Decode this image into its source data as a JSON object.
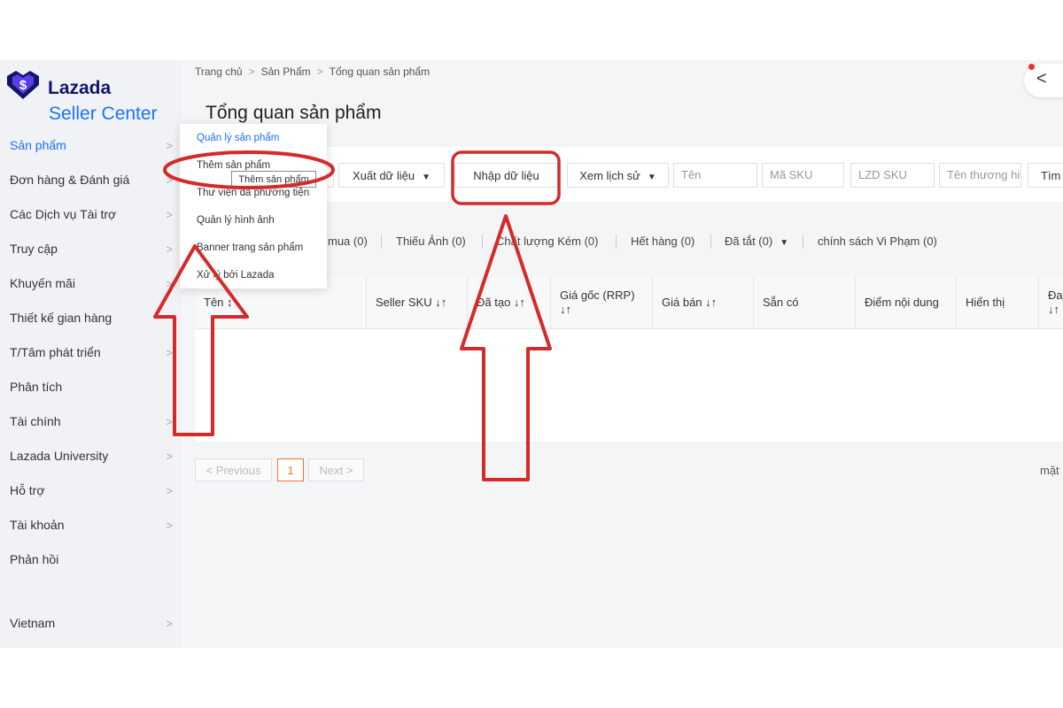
{
  "brand": {
    "name_line1": "Lazada",
    "name_line2": "Seller Center",
    "logo_symbol": "$"
  },
  "sidebar": {
    "items": [
      {
        "label": "Sản phẩm",
        "active": true
      },
      {
        "label": "Đơn hàng & Đánh giá"
      },
      {
        "label": "Các Dịch vụ Tài trợ"
      },
      {
        "label": "Truy cập"
      },
      {
        "label": "Khuyến mãi"
      },
      {
        "label": "Thiết kế gian hàng"
      },
      {
        "label": "T/Tâm phát triển"
      },
      {
        "label": "Phân tích"
      },
      {
        "label": "Tài chính"
      },
      {
        "label": "Lazada University"
      },
      {
        "label": "Hỗ trợ"
      },
      {
        "label": "Tài khoản"
      },
      {
        "label": "Phản hồi"
      }
    ],
    "region": "Vietnam",
    "chevron": ">"
  },
  "breadcrumb": [
    "Trang chủ",
    "Sản Phẩm",
    "Tổng quan sản phẩm"
  ],
  "breadcrumb_sep": ">",
  "page_title": "Tổng quan sản phẩm",
  "collapse_icon": "<",
  "dropdown": {
    "items": [
      "Quản lý sản phẩm",
      "Thêm sản phẩm",
      "Thư viện đa phương tiện",
      "Quản lý hình ảnh",
      "Banner trang sản phẩm",
      "Xử lý bởi Lazada"
    ],
    "tooltip": "Thêm sản phẩm"
  },
  "toolbar": {
    "export_label": "Xuất dữ liệu",
    "import_label": "Nhập dữ liệu",
    "history_label": "Xem lịch sử",
    "search_label": "Tìm",
    "placeholders": {
      "name": "Tên",
      "sku": "Mã SKU",
      "lzd_sku": "LZD SKU",
      "brand": "Tên thương hiệu"
    },
    "caret": "▼"
  },
  "filters": {
    "partial": "mua (0)",
    "missing_images": "Thiếu Ảnh (0)",
    "poor_quality": "Chất lượng Kém (0)",
    "out_of_stock": "Hết hàng (0)",
    "deactivated": "Đã tắt (0)",
    "policy_violation": "chính sách Vi Phạm (0)"
  },
  "table": {
    "columns": [
      "Tên ↕",
      "Seller SKU ↓↑",
      "Đã tạo ↓↑",
      "Giá gốc (RRP) ↓↑",
      "Giá bán ↓↑",
      "Sẵn có",
      "Điểm nội dung",
      "Hiển thị",
      "Đa ↓↑"
    ]
  },
  "pagination": {
    "previous": "< Previous",
    "current": "1",
    "next": "Next >",
    "right_text": "mặt"
  },
  "colors": {
    "lazada_navy": "#0f156d",
    "lazada_blue": "#1a71ff",
    "page_accent": "#f57224",
    "annotation_red": "#d42a2a"
  }
}
